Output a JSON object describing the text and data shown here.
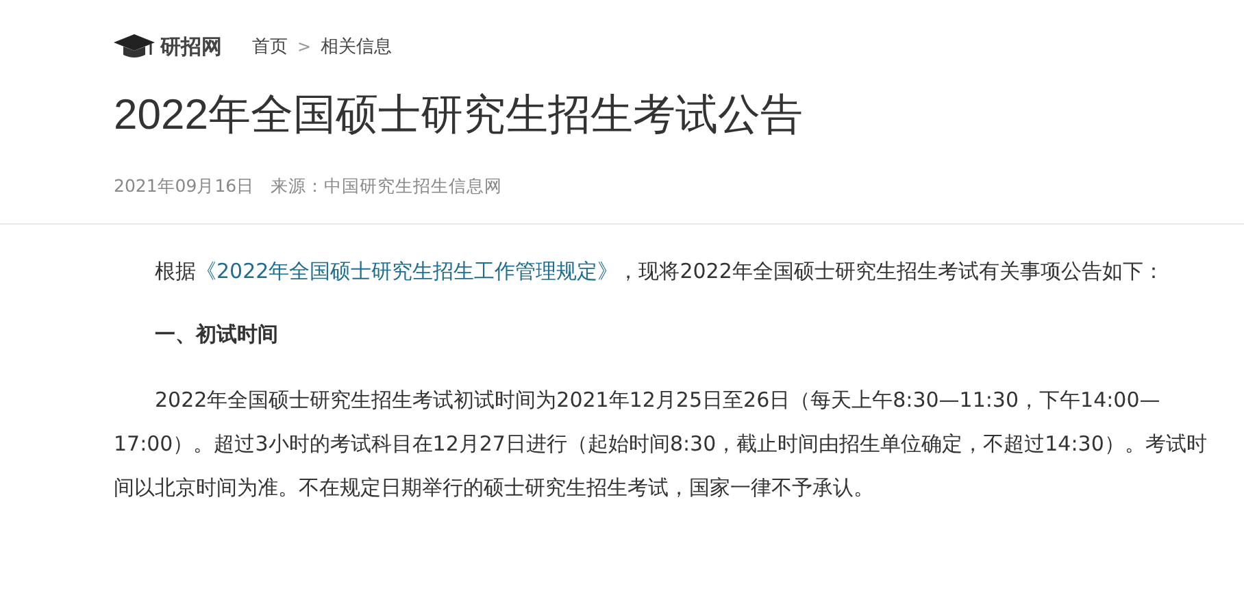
{
  "site": {
    "name": "研招网"
  },
  "breadcrumb": [
    {
      "label": "首页"
    },
    {
      "label": "相关信息"
    }
  ],
  "breadcrumb_separator": ">",
  "title": "2022年全国硕士研究生招生考试公告",
  "meta": {
    "date": "2021年09月16日",
    "source": "来源：中国研究生招生信息网"
  },
  "content": [
    {
      "kind": "paragraph",
      "before": "根据",
      "link": "《2022年全国硕士研究生招生工作管理规定》",
      "after": "，现将2022年全国硕士研究生招生考试有关事项公告如下："
    },
    {
      "kind": "heading",
      "text": "一、初试时间"
    },
    {
      "kind": "paragraph",
      "before": "2022年全国硕士研究生招生考试初试时间为2021年12月25日至26日（每天上午8:30—11:30，下午14:00—17:00）。超过3小时的考试科目在12月27日进行（起始时间8:30，截止时间由招生单位确定，不超过14:30）。考试时间以北京时间为准。不在规定日期举行的硕士研究生招生考试，国家一律不予承认。"
    }
  ]
}
